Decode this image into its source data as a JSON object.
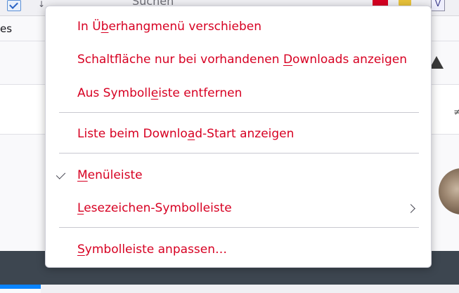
{
  "background": {
    "search_placeholder": "Suchen",
    "tab_fragment": "es",
    "extension_label": "V",
    "small_glyph": "≠"
  },
  "menu": {
    "items": [
      {
        "pre": "In Ü",
        "acc": "b",
        "post": "erhangmenü verschieben"
      },
      {
        "pre": "Schaltfläche nur bei vorhandenen ",
        "acc": "D",
        "post": "ownloads anzeigen"
      },
      {
        "pre": "Aus Symboll",
        "acc": "e",
        "post": "iste entfernen"
      },
      {
        "pre": "Liste beim Downlo",
        "acc": "a",
        "post": "d-Start anzeigen"
      },
      {
        "pre": "",
        "acc": "M",
        "post": "enüleiste",
        "checked": true
      },
      {
        "pre": "",
        "acc": "L",
        "post": "esezeichen-Symbolleiste",
        "submenu": true
      },
      {
        "pre": "",
        "acc": "S",
        "post": "ymbolleiste anpassen…"
      }
    ]
  },
  "colors": {
    "menu_text": "#d70022",
    "accent_blue": "#0a84ff",
    "dark_band": "#3d4650"
  }
}
